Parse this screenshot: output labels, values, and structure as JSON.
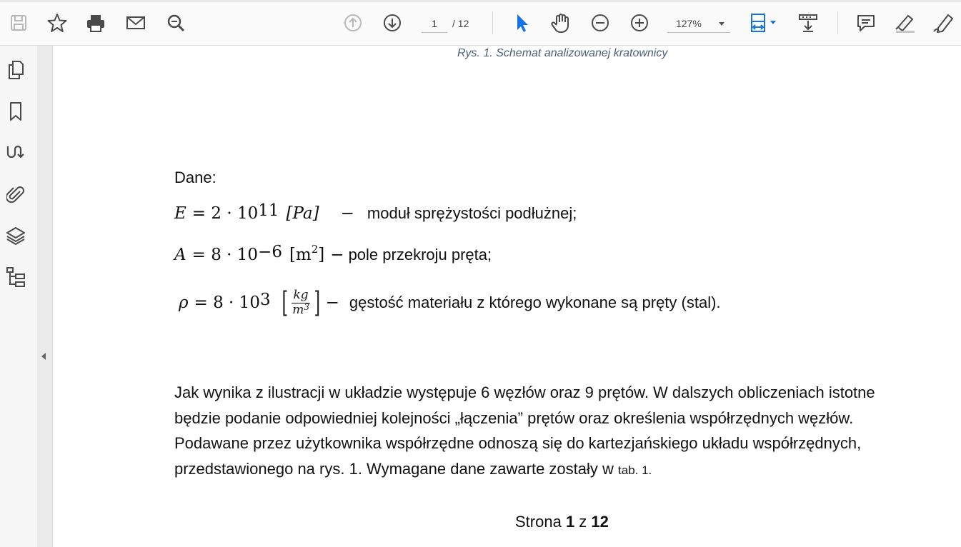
{
  "toolbar": {
    "page_current": "1",
    "page_total": "/ 12",
    "zoom": "127%",
    "icons": [
      "save-icon",
      "star-icon",
      "print-icon",
      "mail-icon",
      "search-icon",
      "page-up-icon",
      "page-down-icon",
      "select-cursor-icon",
      "hand-icon",
      "zoom-out-icon",
      "zoom-in-icon",
      "fit-page-icon",
      "scroll-mode-icon",
      "comment-icon",
      "highlight-icon",
      "sign-icon"
    ]
  },
  "sidebar": {
    "icons": [
      "pages-icon",
      "bookmark-icon",
      "signature-icon",
      "attachment-icon",
      "layers-icon",
      "tree-icon"
    ]
  },
  "document": {
    "caption": "Rys.  1.  Schemat analizowanej kratownicy",
    "dane_label": "Dane:",
    "eq1": {
      "lhs": "E",
      "value": "= 2 · 10",
      "exp": "11",
      "unit": "[Pa]",
      "dash": "−",
      "desc": "moduł sprężystości podłużnej;"
    },
    "eq2": {
      "lhs": "A",
      "value": "= 8 · 10",
      "exp": "−6",
      "unit_open": "[m",
      "unit_exp": "2",
      "unit_close": "]",
      "dash": "−",
      "desc": "pole przekroju pręta;"
    },
    "eq3": {
      "lhs": "ρ",
      "value": "= 8 · 10",
      "exp": "3",
      "frac_num": "kg",
      "frac_den": "m",
      "frac_den_exp": "3",
      "dash": "−",
      "desc": "gęstość materiału z którego wykonane są pręty (stal)."
    },
    "para_line1": "Jak wynika z ilustracji w układzie występuje 6 węzłów oraz 9 prętów. W dalszych obliczeniach istotne",
    "para_line2": "będzie podanie odpowiedniej kolejności „łączenia” prętów oraz określenia współrzędnych węzłów.",
    "para_line3": "Podawane przez użytkownika współrzędne odnoszą się do kartezjańskiego układu współrzędnych,",
    "para_line4a": "przedstawionego na rys.  1. Wymagane dane zawarte zostały w ",
    "para_line4b": "tab.  1.",
    "footer_pre": "Strona ",
    "footer_page": "1",
    "footer_mid": " z ",
    "footer_total": "12"
  },
  "colors": {
    "accent": "#1473e6",
    "caption": "#4b5e7a",
    "icon": "#4a4a4a"
  }
}
